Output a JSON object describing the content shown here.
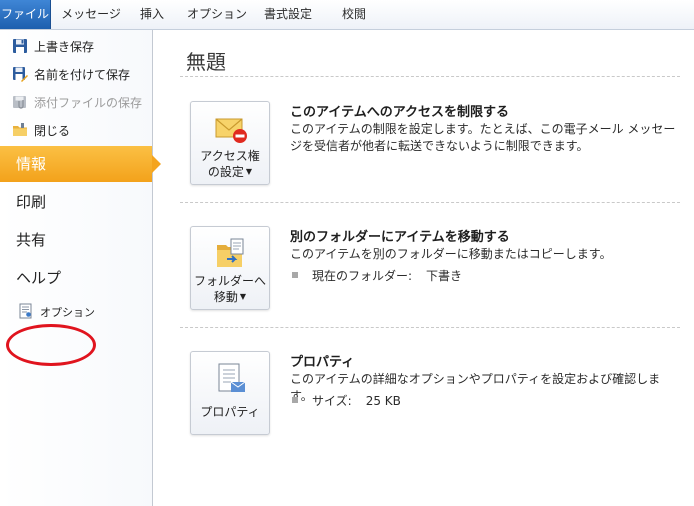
{
  "ribbon": {
    "tabs": [
      {
        "label": "ファイル",
        "active": true
      },
      {
        "label": "メッセージ"
      },
      {
        "label": "挿入"
      },
      {
        "label": "オプション"
      },
      {
        "label": "書式設定"
      },
      {
        "label": "校閲"
      }
    ],
    "accent_color": "#2a6ebd"
  },
  "backstage": {
    "commands": [
      {
        "label": "上書き保存",
        "icon": "floppy-disk-icon",
        "enabled": true
      },
      {
        "label": "名前を付けて保存",
        "icon": "save-as-icon",
        "enabled": true
      },
      {
        "label": "添付ファイルの保存",
        "icon": "attachment-save-icon",
        "enabled": false
      },
      {
        "label": "閉じる",
        "icon": "folder-close-icon",
        "enabled": true
      }
    ],
    "nav": [
      {
        "label": "情報",
        "active": true
      },
      {
        "label": "印刷"
      },
      {
        "label": "共有"
      },
      {
        "label": "ヘルプ"
      }
    ],
    "options_label": "オプション",
    "highlight_color": "#f3a21b"
  },
  "main": {
    "title": "無題",
    "sections": [
      {
        "button_line1": "アクセス権",
        "button_line2": "の設定",
        "heading": "このアイテムへのアクセスを制限する",
        "description": "このアイテムの制限を設定します。たとえば、この電子メール メッセージを受信者が他者に転送できないように制限できます。"
      },
      {
        "button_line1": "フォルダーへ",
        "button_line2": "移動",
        "heading": "別のフォルダーにアイテムを移動する",
        "description": "このアイテムを別のフォルダーに移動またはコピーします。",
        "property_label": "現在のフォルダー:",
        "property_value": "下書き"
      },
      {
        "button_line1": "プロパティ",
        "heading": "プロパティ",
        "description": "このアイテムの詳細なオプションやプロパティを設定および確認します。",
        "property_label": "サイズ:",
        "property_value": "25 KB"
      }
    ]
  }
}
